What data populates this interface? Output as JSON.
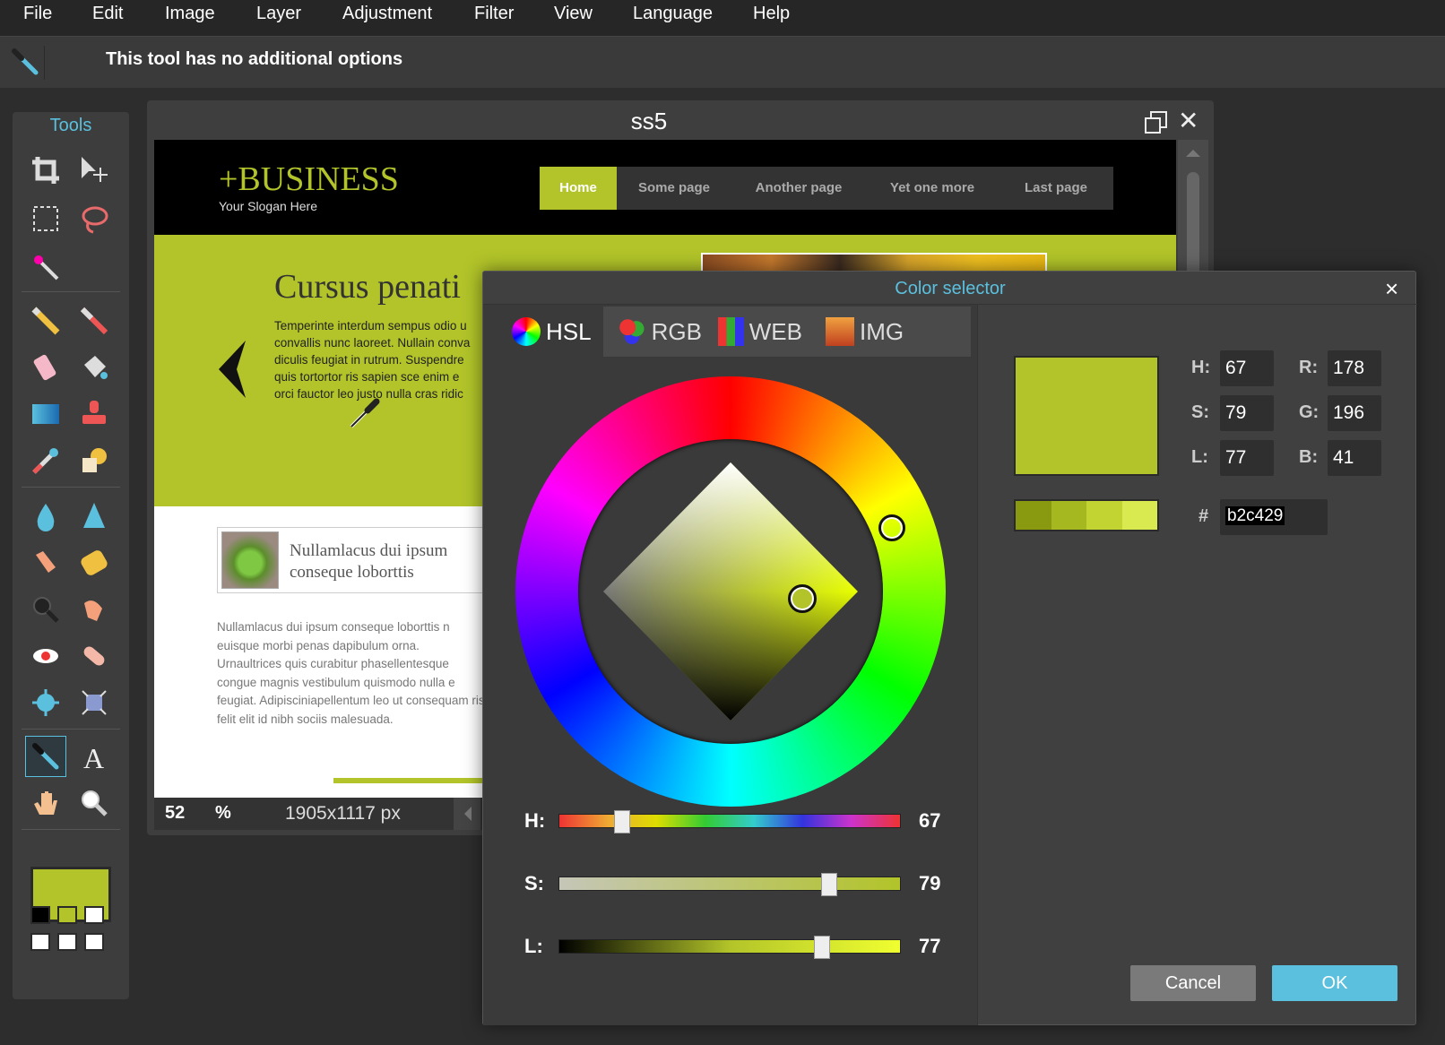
{
  "menu": [
    "File",
    "Edit",
    "Image",
    "Layer",
    "Adjustment",
    "Filter",
    "View",
    "Language",
    "Help"
  ],
  "options_bar": {
    "message": "This tool has no additional options"
  },
  "tools_panel": {
    "title": "Tools",
    "foreground_color": "#b2c429",
    "tools": [
      "crop-icon",
      "move-icon",
      "marquee-icon",
      "lasso-icon",
      "magic-wand-icon",
      "pencil-icon",
      "brush-icon",
      "eraser-icon",
      "bucket-icon",
      "gradient-icon",
      "stamp-icon",
      "color-replace-icon",
      "shape-icon",
      "drop-icon",
      "sharpen-icon",
      "smudge-icon",
      "sponge-icon",
      "burn-icon",
      "dodge-icon",
      "red-eye-icon",
      "heal-icon",
      "bloat-icon",
      "pinch-icon",
      "eyedropper-icon",
      "text-icon",
      "hand-icon",
      "zoom-icon"
    ]
  },
  "document": {
    "title": "ss5",
    "zoom": "52",
    "zoom_unit": "%",
    "dimensions": "1905x1117 px",
    "site": {
      "logo": "+BUSINESS",
      "slogan": "Your Slogan Here",
      "nav": [
        "Home",
        "Some page",
        "Another page",
        "Yet one more",
        "Last page"
      ],
      "hero_title": "Cursus penati",
      "hero_text": "Temperinte interdum sempus odio u convallis nunc laoreet. Nullain conva diculis feugiat in rutrum. Suspendre quis tortortor ris sapien sce enim e orci fauctor leo justo nulla cras ridic",
      "box_head_1": "Nullamlacus dui ipsum",
      "box_head_2": "conseque loborttis",
      "body_text": "Nullamlacus dui ipsum conseque loborttis n euisque morbi penas dapibulum orna. Urnaultrices quis curabitur phasellentesque congue magnis vestibulum quismodo nulla e feugiat. Adipisciniapellentum leo ut consequam ris felit elit id nibh sociis malesuada."
    }
  },
  "color_selector": {
    "title": "Color selector",
    "tabs": [
      "HSL",
      "RGB",
      "WEB",
      "IMG"
    ],
    "active_tab": "HSL",
    "h_label": "H:",
    "s_label": "S:",
    "l_label": "L:",
    "r_label": "R:",
    "g_label": "G:",
    "b_label": "B:",
    "hash_label": "#",
    "h": "67",
    "s": "79",
    "l": "77",
    "r": "178",
    "g": "196",
    "b": "41",
    "hex": "b2c429",
    "hue_fraction": 0.186,
    "sat_fraction": 0.79,
    "light_fraction": 0.77,
    "current_color": "#b2c429",
    "shades": [
      "#8a9a10",
      "#a6b81f",
      "#c2d432",
      "#d9ea50"
    ],
    "cancel_label": "Cancel",
    "ok_label": "OK"
  }
}
